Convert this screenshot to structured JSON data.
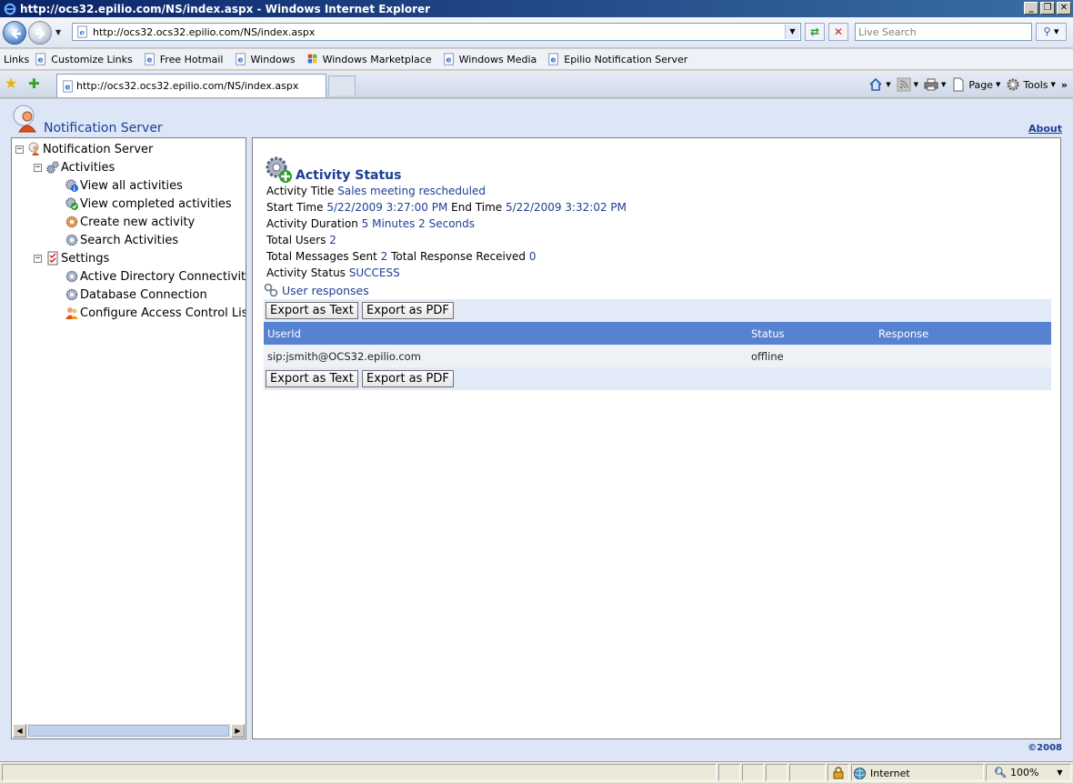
{
  "window": {
    "title": "http://ocs32.epilio.com/NS/index.aspx - Windows Internet Explorer"
  },
  "address": {
    "url": "http://ocs32.ocs32.epilio.com/NS/index.aspx",
    "search_placeholder": "Live Search"
  },
  "links_bar": {
    "label": "Links",
    "items": [
      {
        "label": "Customize Links"
      },
      {
        "label": "Free Hotmail"
      },
      {
        "label": "Windows"
      },
      {
        "label": "Windows Marketplace"
      },
      {
        "label": "Windows Media"
      },
      {
        "label": "Epilio Notification Server"
      }
    ]
  },
  "tab": {
    "title": "http://ocs32.ocs32.epilio.com/NS/index.aspx"
  },
  "command_bar": {
    "page_label": "Page",
    "tools_label": "Tools"
  },
  "app": {
    "title": "Notification Server",
    "about_label": "About",
    "copyright": "©2008"
  },
  "tree": {
    "root": "Notification Server",
    "activities": {
      "label": "Activities",
      "items": [
        {
          "label": "View all activities"
        },
        {
          "label": "View completed activities"
        },
        {
          "label": "Create new activity"
        },
        {
          "label": "Search Activities"
        }
      ]
    },
    "settings": {
      "label": "Settings",
      "items": [
        {
          "label": "Active Directory Connectivity"
        },
        {
          "label": "Database Connection"
        },
        {
          "label": "Configure Access Control List"
        }
      ]
    }
  },
  "activity": {
    "heading": "Activity Status",
    "title_label": "Activity Title",
    "title_value": "Sales meeting rescheduled",
    "start_label": "Start Time",
    "start_value": "5/22/2009 3:27:00 PM",
    "end_label": "End Time",
    "end_value": "5/22/2009 3:32:02 PM",
    "duration_label": "Activity Duration",
    "duration_value": "5 Minutes 2 Seconds",
    "total_users_label": "Total Users",
    "total_users_value": "2",
    "msgs_sent_label": "Total Messages Sent",
    "msgs_sent_value": "2",
    "resp_label": "Total Response Received",
    "resp_value": "0",
    "status_label": "Activity Status",
    "status_value": "SUCCESS"
  },
  "responses": {
    "heading": "User responses",
    "export_text_label": "Export as Text",
    "export_pdf_label": "Export as PDF",
    "columns": [
      "UserId",
      "Status",
      "Response"
    ],
    "rows": [
      {
        "userid": "sip:jsmith@OCS32.epilio.com",
        "status": "offline",
        "response": ""
      }
    ]
  },
  "status_bar": {
    "zone": "Internet",
    "zoom": "100%"
  }
}
